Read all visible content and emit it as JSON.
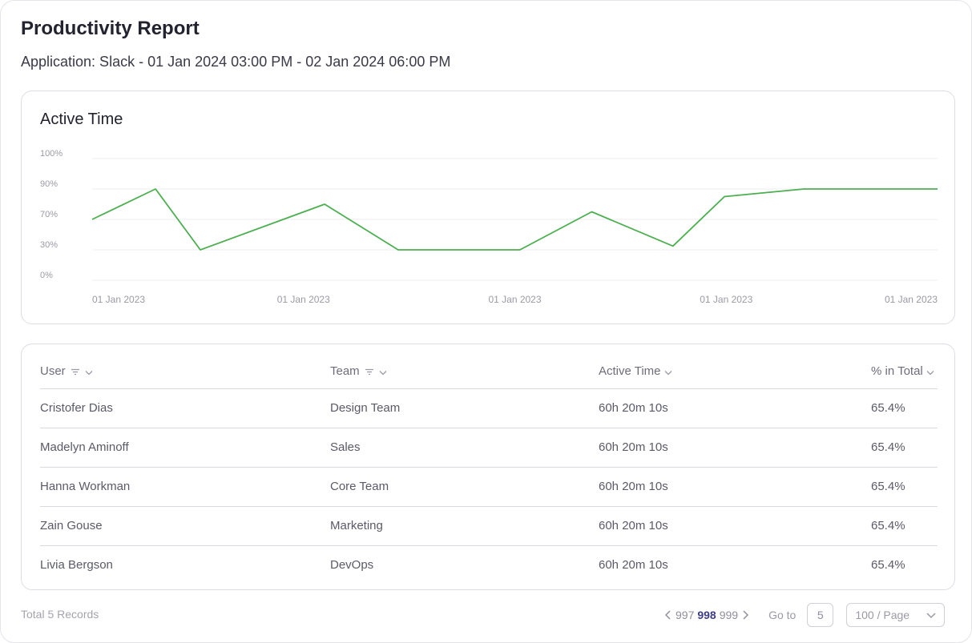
{
  "header": {
    "title": "Productivity Report",
    "subtitle": "Application: Slack - 01 Jan 2024 03:00 PM - 02 Jan 2024 06:00 PM"
  },
  "chart": {
    "title": "Active Time"
  },
  "chart_data": {
    "type": "line",
    "title": "Active Time",
    "xlabel": "",
    "ylabel": "",
    "y_tick_labels": [
      "100%",
      "90%",
      "70%",
      "30%",
      "0%"
    ],
    "x_tick_labels": [
      "01 Jan 2023",
      "01 Jan 2023",
      "01 Jan 2023",
      "01 Jan 2023",
      "01 Jan 2023"
    ],
    "grid": true,
    "series": [
      {
        "color": "#4caf50",
        "points": [
          {
            "x": 0,
            "y": 70
          },
          {
            "x": 0.075,
            "y": 90
          },
          {
            "x": 0.128,
            "y": 30
          },
          {
            "x": 0.275,
            "y": 80
          },
          {
            "x": 0.362,
            "y": 30
          },
          {
            "x": 0.506,
            "y": 30
          },
          {
            "x": 0.591,
            "y": 75
          },
          {
            "x": 0.687,
            "y": 35
          },
          {
            "x": 0.748,
            "y": 85
          },
          {
            "x": 0.842,
            "y": 90
          },
          {
            "x": 1,
            "y": 90
          }
        ]
      }
    ]
  },
  "table": {
    "columns": [
      {
        "label": "User",
        "filter": true
      },
      {
        "label": "Team",
        "filter": true
      },
      {
        "label": "Active Time",
        "filter": false
      },
      {
        "label": "% in Total",
        "filter": false
      }
    ],
    "rows": [
      [
        "Cristofer Dias",
        "Design Team",
        "60h 20m 10s",
        "65.4%"
      ],
      [
        "Madelyn Aminoff",
        "Sales",
        "60h 20m 10s",
        "65.4%"
      ],
      [
        "Hanna Workman",
        "Core Team",
        "60h 20m 10s",
        "65.4%"
      ],
      [
        "Zain Gouse",
        "Marketing",
        "60h 20m 10s",
        "65.4%"
      ],
      [
        "Livia Bergson",
        "DevOps",
        "60h 20m 10s",
        "65.4%"
      ]
    ]
  },
  "footer": {
    "total": "Total 5 Records",
    "pages": [
      "997",
      "998",
      "999"
    ],
    "current_page": "998",
    "goto_label": "Go to",
    "goto_value": "5",
    "page_size": "100 / Page"
  },
  "icons": {
    "filter": "filter-icon",
    "sort": "chevron-down-icon",
    "prev": "chevron-left-icon",
    "next": "chevron-right-icon"
  },
  "colors": {
    "line": "#4caf50",
    "active_page": "#3c3c8c"
  }
}
